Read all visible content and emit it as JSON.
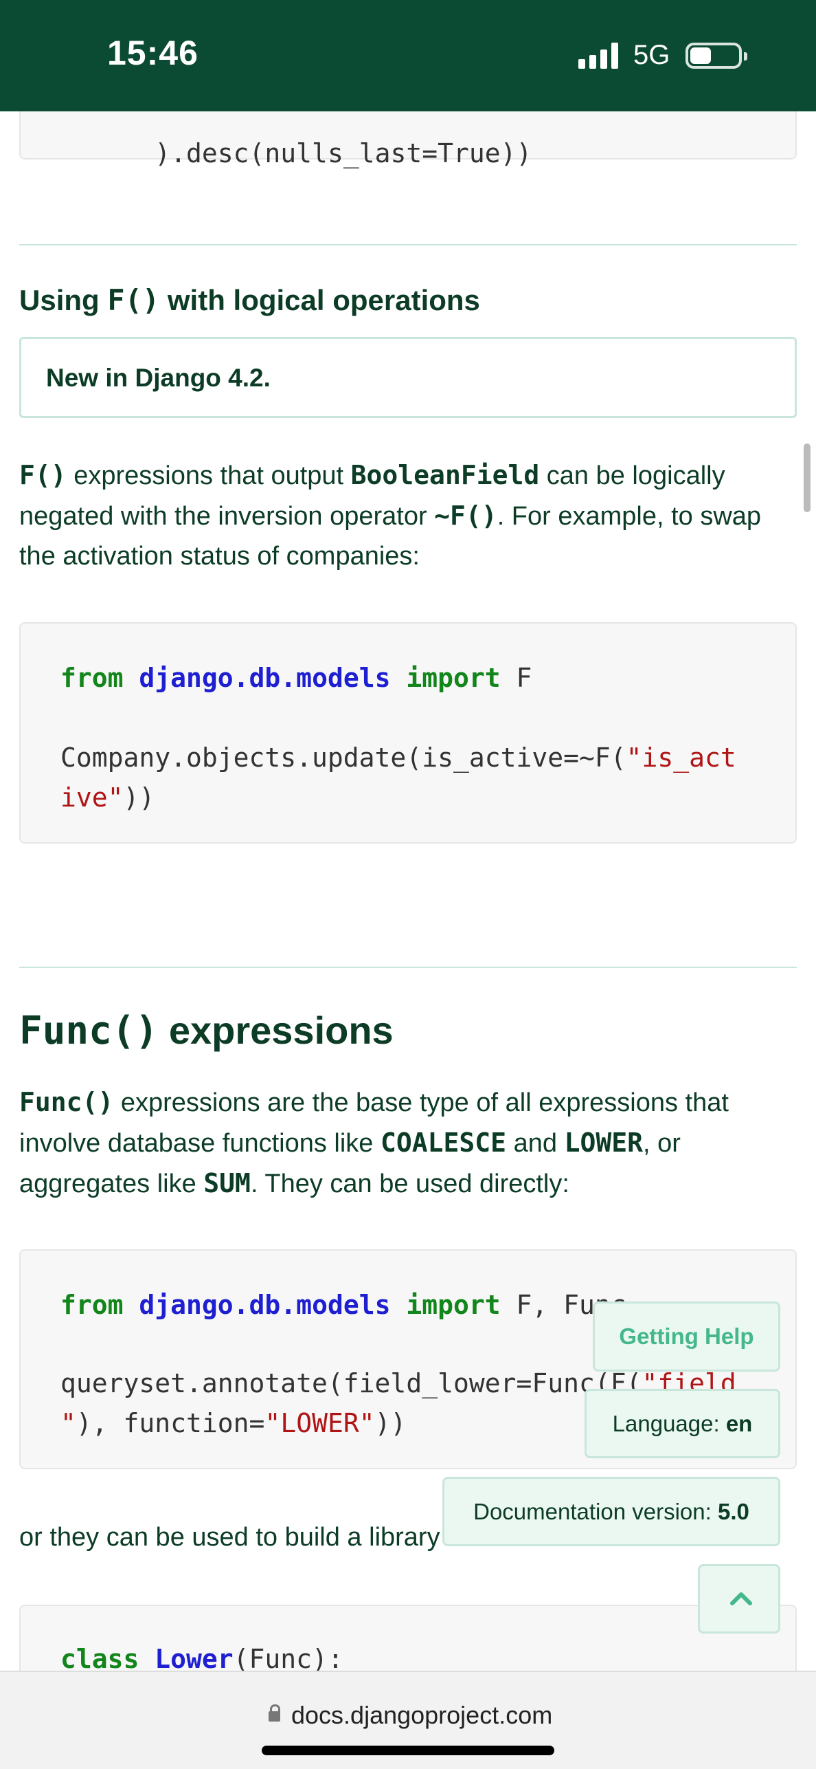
{
  "status_bar": {
    "time": "15:46",
    "network": "5G",
    "icons": [
      "signal-icon",
      "battery-icon"
    ]
  },
  "top_code_fragment": {
    "text": ").desc(nulls_last=True))"
  },
  "section_f_logical": {
    "title_prefix": "Using ",
    "title_code": "F()",
    "title_suffix": " with logical operations",
    "version_note": "New in Django 4.2.",
    "para": {
      "part1_code": "F()",
      "part2": " expressions that output ",
      "part3_code": "BooleanField",
      "part4": " can be logically",
      "line2_a": "negated with the inversion operator ",
      "line2_code": "~F()",
      "line2_b": ". For example, to swap",
      "line3": "the activation status of companies:"
    },
    "code": {
      "line1_kw": "from",
      "line1_mod": "django.db.models",
      "line1_kw2": "import",
      "line1_rest": "F",
      "line2_a": "Company.objects.update(is_active=~F(",
      "line2_str": "\"is_act",
      "line3_str": "ive\"",
      "line3_b": "))"
    }
  },
  "section_func": {
    "title_code": "Func()",
    "title_suffix": " expressions",
    "para": {
      "code1": "Func()",
      "text1": " expressions are the base type of all expressions that",
      "text2": "involve database functions like ",
      "code2": "COALESCE",
      "text3": " and ",
      "code3": "LOWER",
      "text4": ", or",
      "text5": "aggregates like ",
      "code4": "SUM",
      "text6": ". They can be used directly:"
    },
    "code": {
      "line1_kw": "from",
      "line1_mod": "django.db.models",
      "line1_kw2": "import",
      "line1_rest": "F, Func",
      "line2_a": "queryset.annotate(field_lower=Func(F(",
      "line2_str": "\"field",
      "line3_str": "\"",
      "line3_b": "), function=",
      "line3_str2": "\"LOWER\"",
      "line3_c": "))"
    },
    "para2": "or they can be used to build a library",
    "code2": {
      "line1_kw": "class",
      "line1_cls": "Lower",
      "line1_rest": "(Func):"
    }
  },
  "floating": {
    "getting_help": "Getting Help",
    "language_label": "Language: ",
    "language_value": "en",
    "version_label": "Documentation version: ",
    "version_value": "5.0",
    "back_to_top_icon": "chevron-up-icon"
  },
  "address_bar": {
    "url": "docs.djangoproject.com",
    "icon": "lock-icon"
  }
}
